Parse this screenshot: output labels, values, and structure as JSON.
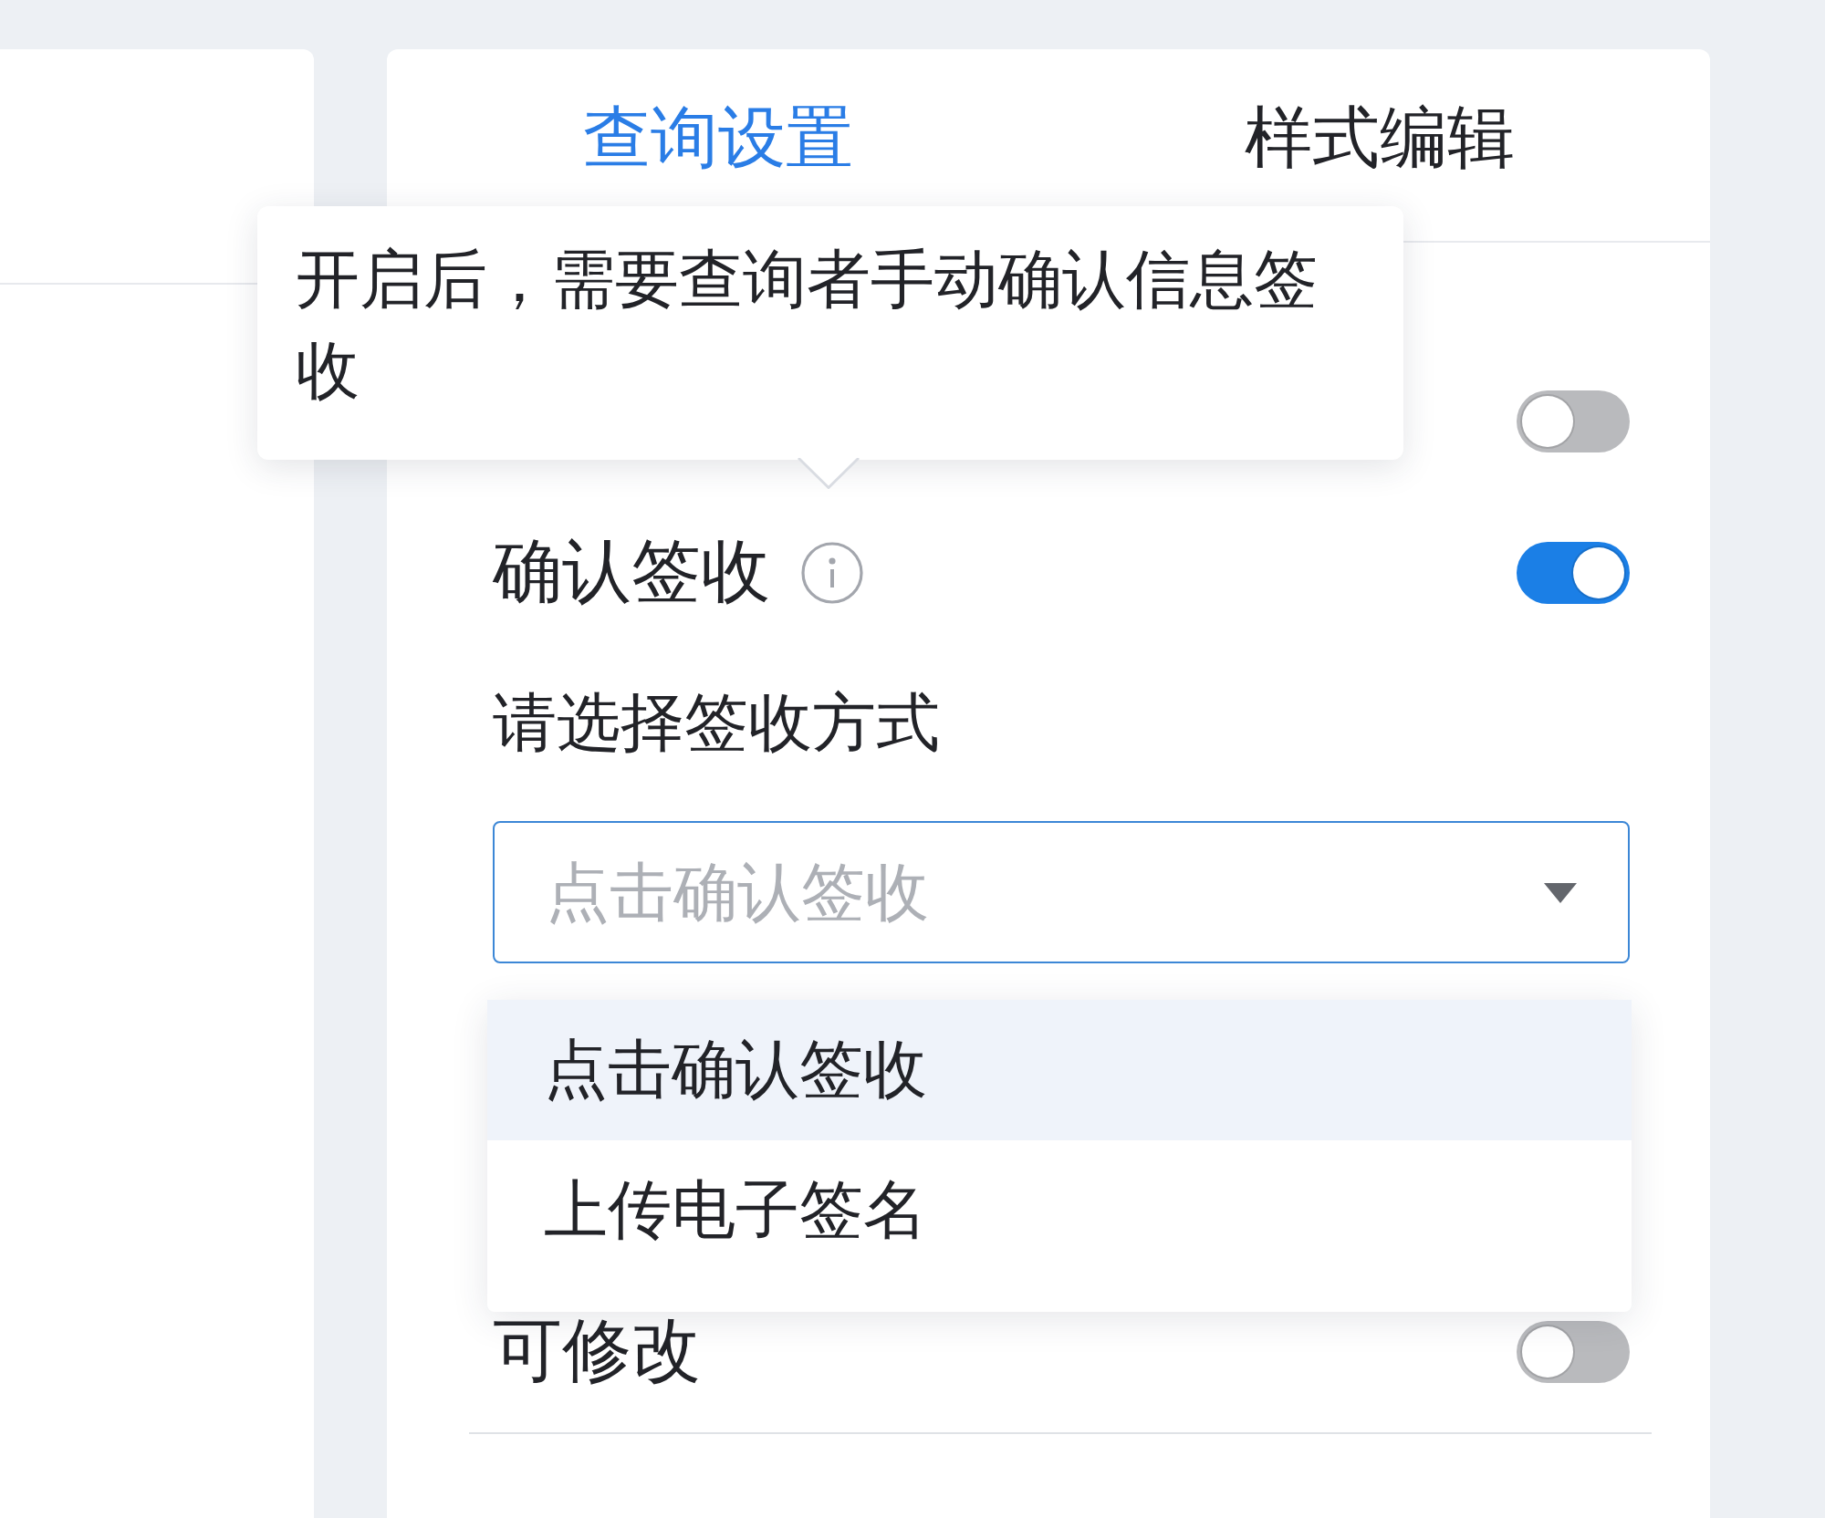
{
  "tabs": [
    {
      "label": "查询设置",
      "selected": true
    },
    {
      "label": "样式编辑",
      "selected": false
    }
  ],
  "settings": [
    {
      "kind": "toggle",
      "on": false
    },
    {
      "kind": "toggle",
      "label": "确认签收",
      "info": {
        "tooltip": "开启后，需要查询者手动确认信息签收",
        "open": true
      },
      "on": true
    },
    {
      "kind": "select",
      "label": "请选择签收方式",
      "placeholder": "点击确认签收",
      "expanded": true,
      "options": [
        {
          "label": "点击确认签收",
          "selected": true
        },
        {
          "label": "上传电子签名",
          "selected": false
        }
      ]
    },
    {
      "kind": "toggle",
      "label": "可修改",
      "on": false
    }
  ]
}
